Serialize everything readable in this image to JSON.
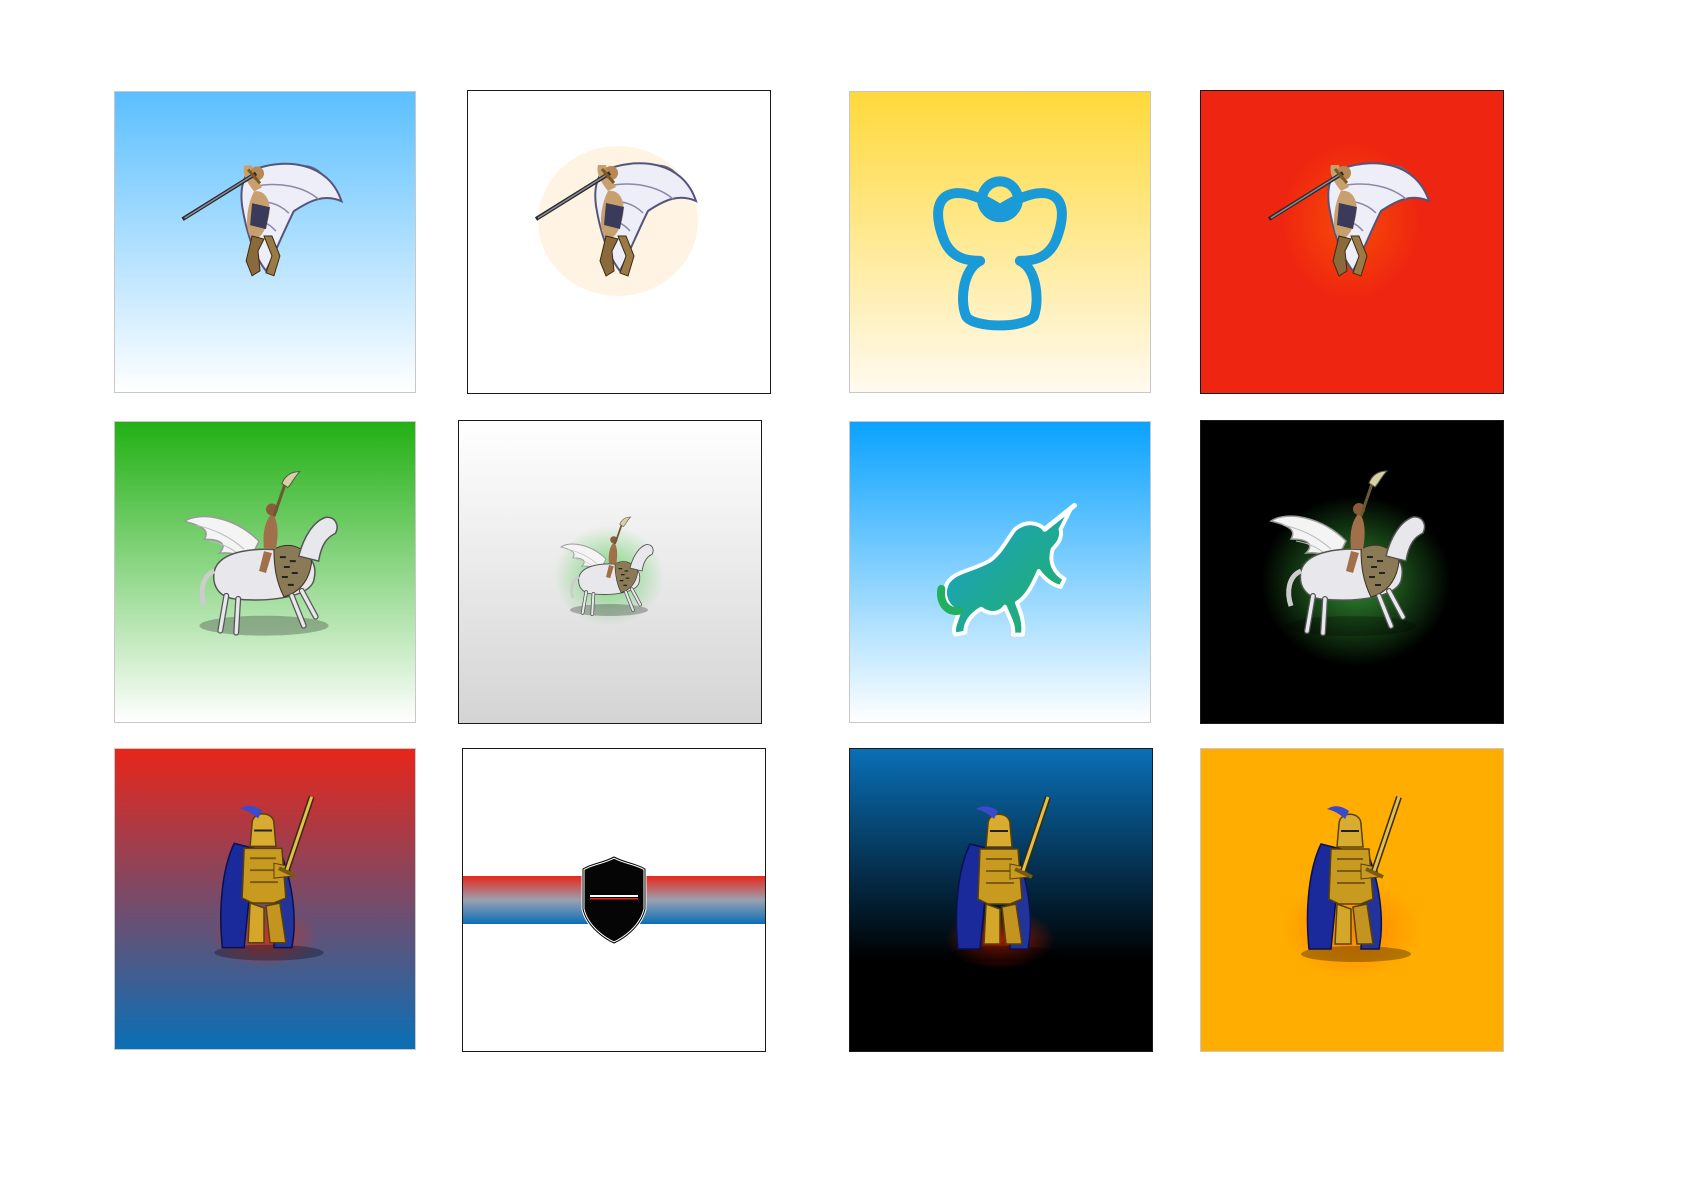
{
  "tiles": [
    {
      "id": "angel-sky",
      "background": [
        "#5bbfff",
        "#ffffff"
      ],
      "subject": "archangel-sprite"
    },
    {
      "id": "angel-white",
      "background": [
        "#ffffff",
        "#ffffff"
      ],
      "subject": "archangel-sprite"
    },
    {
      "id": "angel-icon-yellow",
      "background": [
        "#ffd93a",
        "#fffaf0"
      ],
      "subject": "angel-outline-icon",
      "accent": "#1a9ad6"
    },
    {
      "id": "angel-red",
      "background": [
        "#ee2510",
        "#ee2510"
      ],
      "subject": "archangel-sprite"
    },
    {
      "id": "pegasus-green",
      "background": [
        "#22b014",
        "#ffffff"
      ],
      "subject": "pegasus-rider-sprite"
    },
    {
      "id": "pegasus-grey",
      "background": [
        "#ffffff",
        "#d4d4d4"
      ],
      "subject": "pegasus-rider-sprite"
    },
    {
      "id": "unicorn-icon-blue",
      "background": [
        "#0aa2ff",
        "#ffffff"
      ],
      "subject": "unicorn-icon",
      "accent": [
        "#1aa0d0",
        "#22b060"
      ]
    },
    {
      "id": "pegasus-black",
      "background": [
        "#000000",
        "#000000"
      ],
      "subject": "pegasus-rider-sprite"
    },
    {
      "id": "knight-red-blue",
      "background": [
        "#e8261a",
        "#0a6fb6"
      ],
      "subject": "golden-knight-sprite"
    },
    {
      "id": "shield-stripes",
      "background": [
        "#ffffff",
        "#ffffff"
      ],
      "subject": "black-shield-icon",
      "stripes": [
        "#e8261a",
        "#0a6fb6"
      ]
    },
    {
      "id": "knight-navy",
      "background": [
        "#0a6fb6",
        "#000000"
      ],
      "subject": "golden-knight-sprite"
    },
    {
      "id": "knight-orange",
      "background": [
        "#ffad00",
        "#ffad00"
      ],
      "subject": "golden-knight-sprite"
    }
  ]
}
